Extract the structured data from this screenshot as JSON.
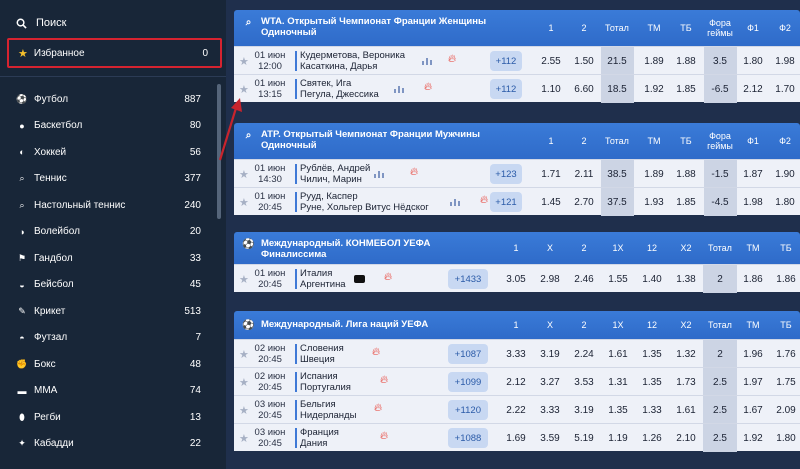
{
  "sidebar": {
    "search_label": "Поиск",
    "favorites_label": "Избранное",
    "favorites_count": "0",
    "sports": [
      {
        "icon": "soccer-ball-icon",
        "glyph": "⚽",
        "label": "Футбол",
        "count": "887"
      },
      {
        "icon": "basketball-icon",
        "glyph": "●",
        "label": "Баскетбол",
        "count": "80"
      },
      {
        "icon": "hockey-puck-icon",
        "glyph": "◐",
        "label": "Хоккей",
        "count": "56"
      },
      {
        "icon": "tennis-racket-icon",
        "glyph": "⌕",
        "label": "Теннис",
        "count": "377"
      },
      {
        "icon": "table-tennis-icon",
        "glyph": "⌕",
        "label": "Настольный теннис",
        "count": "240"
      },
      {
        "icon": "volleyball-icon",
        "glyph": "◑",
        "label": "Волейбол",
        "count": "20"
      },
      {
        "icon": "handball-icon",
        "glyph": "⚑",
        "label": "Гандбол",
        "count": "33"
      },
      {
        "icon": "baseball-icon",
        "glyph": "◒",
        "label": "Бейсбол",
        "count": "45"
      },
      {
        "icon": "cricket-icon",
        "glyph": "✎",
        "label": "Крикет",
        "count": "513"
      },
      {
        "icon": "futsal-icon",
        "glyph": "◓",
        "label": "Футзал",
        "count": "7"
      },
      {
        "icon": "boxing-glove-icon",
        "glyph": "✊",
        "label": "Бокс",
        "count": "48"
      },
      {
        "icon": "mma-icon",
        "glyph": "▬",
        "label": "ММА",
        "count": "74"
      },
      {
        "icon": "rugby-ball-icon",
        "glyph": "⬮",
        "label": "Регби",
        "count": "13"
      },
      {
        "icon": "kabaddi-icon",
        "glyph": "✦",
        "label": "Кабадди",
        "count": "22"
      }
    ]
  },
  "blocks": [
    {
      "icon": "tennis-racket-icon",
      "title": "WTA.  Открытый Чемпионат Франции Женщины\nОдиночный",
      "columns": [
        "1",
        "2",
        "Тотал",
        "ТМ",
        "ТБ",
        "Фора\nгеймы",
        "Ф1",
        "Ф2"
      ],
      "rows": [
        {
          "date": "01 июн",
          "time": "12:00",
          "team1": "Кудерметова, Вероника",
          "team2": "Касаткина, Дарья",
          "more": "+112",
          "odds": [
            "2.55",
            "1.50",
            "21.5",
            "1.89",
            "1.88",
            "3.5",
            "1.80",
            "1.98"
          ]
        },
        {
          "date": "01 июн",
          "time": "13:15",
          "team1": "Святек, Ига",
          "team2": "Пегула, Джессика",
          "more": "+112",
          "odds": [
            "1.10",
            "6.60",
            "18.5",
            "1.92",
            "1.85",
            "-6.5",
            "2.12",
            "1.70"
          ]
        }
      ]
    },
    {
      "icon": "tennis-racket-icon",
      "title": "ATP.  Открытый Чемпионат Франции Мужчины\nОдиночный",
      "columns": [
        "1",
        "2",
        "Тотал",
        "ТМ",
        "ТБ",
        "Фора\nгеймы",
        "Ф1",
        "Ф2"
      ],
      "rows": [
        {
          "date": "01 июн",
          "time": "14:30",
          "team1": "Рублёв, Андрей",
          "team2": "Чилич, Марин",
          "more": "+123",
          "odds": [
            "1.71",
            "2.11",
            "38.5",
            "1.89",
            "1.88",
            "-1.5",
            "1.87",
            "1.90"
          ]
        },
        {
          "date": "01 июн",
          "time": "20:45",
          "team1": "Рууд, Каспер",
          "team2": "Руне, Хольгер Витус Нёдског",
          "more": "+121",
          "odds": [
            "1.45",
            "2.70",
            "37.5",
            "1.93",
            "1.85",
            "-4.5",
            "1.98",
            "1.80"
          ]
        }
      ]
    },
    {
      "icon": "soccer-ball-icon",
      "title": "Международный.  КОНМЕБОЛ УЕФА\nФиналиссима",
      "columns": [
        "1",
        "X",
        "2",
        "1X",
        "12",
        "X2",
        "Тотал",
        "ТМ",
        "ТБ"
      ],
      "rows": [
        {
          "date": "01 июн",
          "time": "20:45",
          "team1": "Италия",
          "team2": "Аргентина",
          "more": "+1433",
          "odds": [
            "3.05",
            "2.98",
            "2.46",
            "1.55",
            "1.40",
            "1.38",
            "2",
            "1.86",
            "1.86"
          ]
        }
      ]
    },
    {
      "icon": "soccer-ball-icon",
      "title": "Международный.  Лига наций УЕФА",
      "columns": [
        "1",
        "X",
        "2",
        "1X",
        "12",
        "X2",
        "Тотал",
        "ТМ",
        "ТБ"
      ],
      "rows": [
        {
          "date": "02 июн",
          "time": "20:45",
          "team1": "Словения",
          "team2": "Швеция",
          "more": "+1087",
          "odds": [
            "3.33",
            "3.19",
            "2.24",
            "1.61",
            "1.35",
            "1.32",
            "2",
            "1.96",
            "1.76"
          ]
        },
        {
          "date": "02 июн",
          "time": "20:45",
          "team1": "Испания",
          "team2": "Португалия",
          "more": "+1099",
          "odds": [
            "2.12",
            "3.27",
            "3.53",
            "1.31",
            "1.35",
            "1.73",
            "2.5",
            "1.97",
            "1.75"
          ]
        },
        {
          "date": "03 июн",
          "time": "20:45",
          "team1": "Бельгия",
          "team2": "Нидерланды",
          "more": "+1120",
          "odds": [
            "2.22",
            "3.33",
            "3.19",
            "1.35",
            "1.33",
            "1.61",
            "2.5",
            "1.67",
            "2.09"
          ]
        },
        {
          "date": "03 июн",
          "time": "20:45",
          "team1": "Франция",
          "team2": "Дания",
          "more": "+1088",
          "odds": [
            "1.69",
            "3.59",
            "5.19",
            "1.19",
            "1.26",
            "2.10",
            "2.5",
            "1.92",
            "1.80"
          ]
        }
      ]
    }
  ]
}
